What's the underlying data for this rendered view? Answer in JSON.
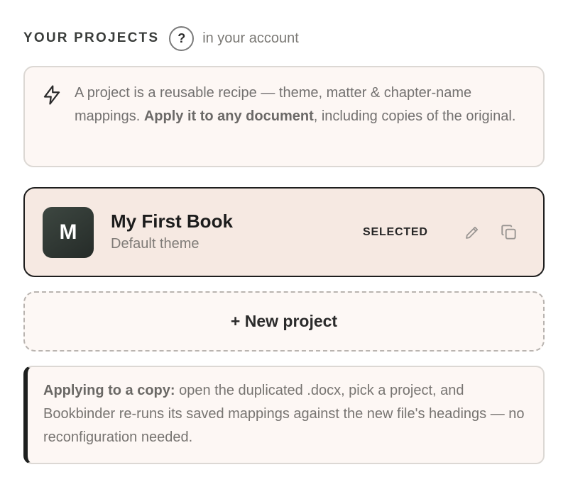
{
  "header": {
    "title": "YOUR PROJECTS",
    "help_label": "?",
    "subtitle": "in your account"
  },
  "info": {
    "icon": "lightning-bolt-icon",
    "text_before": "A project is a reusable recipe — theme, matter & chapter-name mappings. ",
    "text_bold": "Apply it to any document",
    "text_after": ", including copies of the original."
  },
  "project": {
    "avatar_letter": "M",
    "name": "My First Book",
    "theme": "Default theme",
    "status": "SELECTED",
    "edit_icon": "pencil-icon",
    "duplicate_icon": "copy-icon"
  },
  "new_project_label": "+ New project",
  "note": {
    "bold": "Applying to a copy:",
    "text": " open the duplicated .docx, pick a project, and Bookbinder re-runs its saved mappings against the new file's headings — no reconfiguration needed."
  },
  "colors": {
    "card_background": "#f6e9e2",
    "panel_background": "#fdf7f4",
    "accent_dark": "#1d1f1e"
  }
}
